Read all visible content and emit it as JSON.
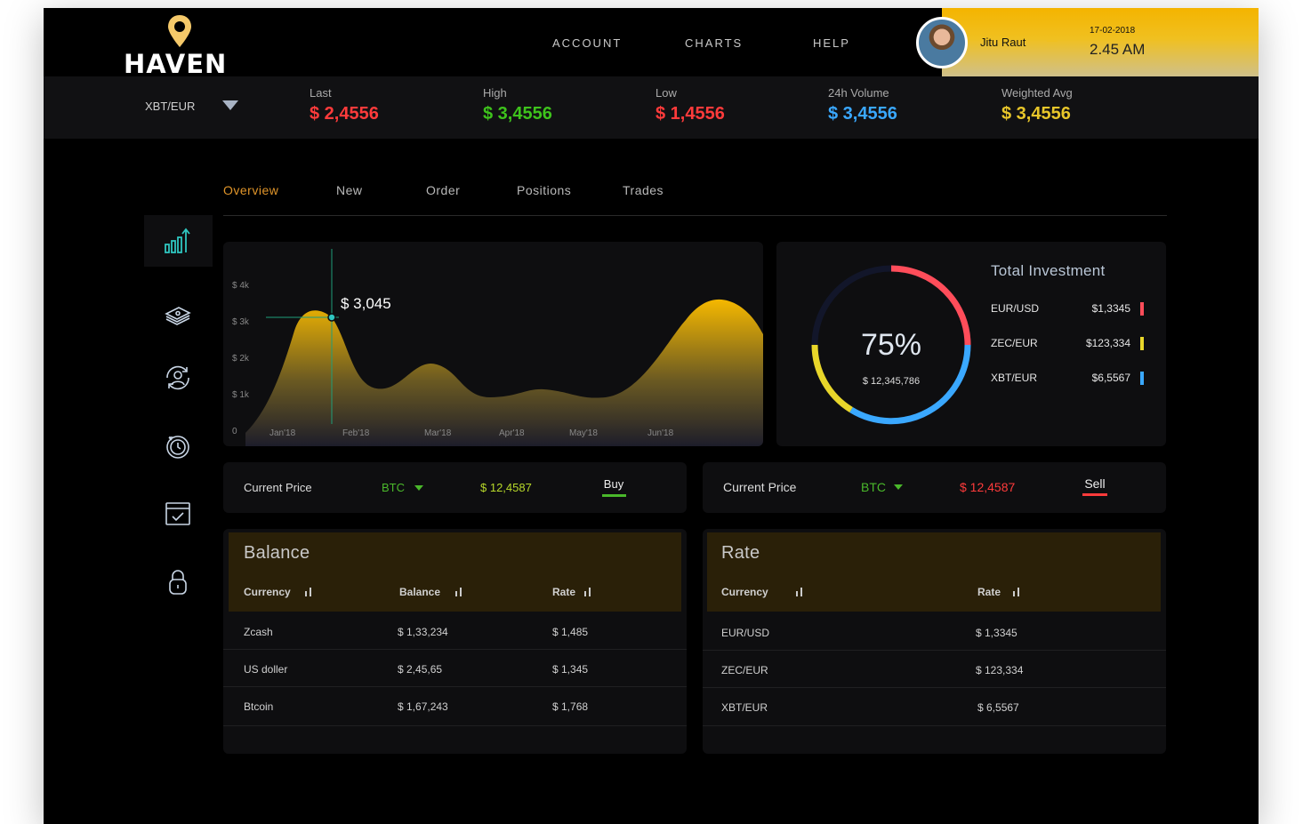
{
  "brand": {
    "name": "HAVEN"
  },
  "nav": {
    "account": "ACCOUNT",
    "charts": "CHARTS",
    "help": "HELP"
  },
  "user": {
    "name": "Jitu Raut",
    "date": "17-02-2018",
    "time": "2.45 AM"
  },
  "ticker": {
    "pair": "XBT/EUR",
    "stats": [
      {
        "label": "Last",
        "value": "$ 2,4556",
        "color": "#ff3b3b"
      },
      {
        "label": "High",
        "value": "$ 3,4556",
        "color": "#3ec31c"
      },
      {
        "label": "Low",
        "value": "$ 1,4556",
        "color": "#ff3b3b"
      },
      {
        "label": "24h Volume",
        "value": "$ 3,4556",
        "color": "#3aa8ff"
      },
      {
        "label": "Weighted Avg",
        "value": "$ 3,4556",
        "color": "#e8c62a"
      }
    ]
  },
  "sidebar": {
    "items": [
      "chart-growth-icon",
      "money-stack-icon",
      "user-sync-icon",
      "history-clock-icon",
      "calendar-check-icon",
      "lock-icon"
    ]
  },
  "tabs": [
    "Overview",
    "New",
    "Order",
    "Positions",
    "Trades"
  ],
  "chart_data": {
    "type": "area",
    "x": [
      "Jan'18",
      "Feb'18",
      "Mar'18",
      "Apr'18",
      "May'18",
      "Jun'18"
    ],
    "yticks": [
      "0",
      "$ 1k",
      "$ 2k",
      "$ 3k",
      "$ 4k"
    ],
    "ylim": [
      0,
      4000
    ],
    "tooltip": "$ 3,045",
    "accent": "#f5b800"
  },
  "investment": {
    "title": "Total Investment",
    "percent": "75%",
    "total": "$ 12,345,786",
    "items": [
      {
        "name": "EUR/USD",
        "value": "$1,3345",
        "color": "#ff4d5a"
      },
      {
        "name": "ZEC/EUR",
        "value": "$123,334",
        "color": "#e8d62a"
      },
      {
        "name": "XBT/EUR",
        "value": "$6,5567",
        "color": "#3aa8ff"
      }
    ]
  },
  "buy": {
    "label": "Current Price",
    "currency": "BTC",
    "price": "$ 12,4587",
    "action": "Buy"
  },
  "sell": {
    "label": "Current Price",
    "currency": "BTC",
    "price": "$ 12,4587",
    "action": "Sell"
  },
  "balance": {
    "title": "Balance",
    "headers": [
      "Currency",
      "Balance",
      "Rate"
    ],
    "rows": [
      [
        "Zcash",
        "$ 1,33,234",
        "$ 1,485"
      ],
      [
        "US doller",
        "$ 2,45,65",
        "$ 1,345"
      ],
      [
        "Btcoin",
        "$ 1,67,243",
        "$ 1,768"
      ]
    ]
  },
  "rate": {
    "title": "Rate",
    "headers": [
      "Currency",
      "Rate"
    ],
    "rows": [
      [
        "EUR/USD",
        "$ 1,3345"
      ],
      [
        "ZEC/EUR",
        "$ 123,334"
      ],
      [
        "XBT/EUR",
        "$ 6,5567"
      ]
    ]
  }
}
